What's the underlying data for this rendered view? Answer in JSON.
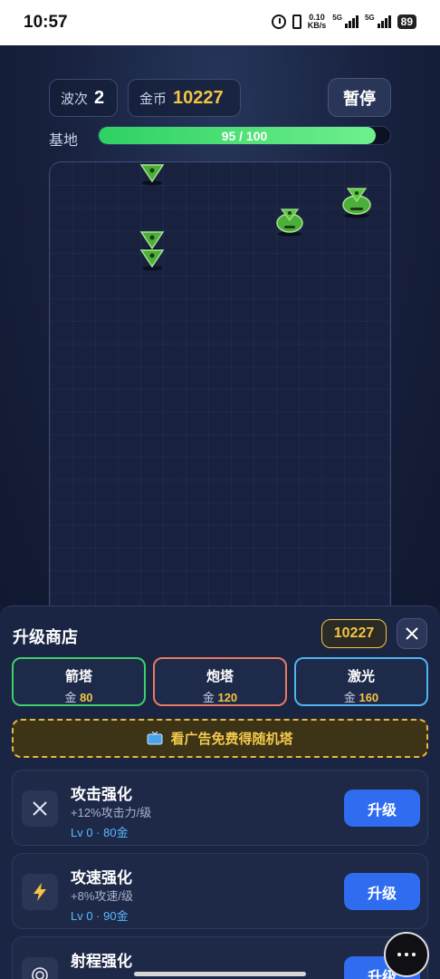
{
  "status_bar": {
    "time": "10:57",
    "net_speed_value": "0.10",
    "net_speed_unit": "KB/s",
    "sim1_label": "5G",
    "sim2_label": "5G",
    "battery": "89"
  },
  "hud": {
    "wave_label": "波次",
    "wave_value": "2",
    "gold_label": "金币",
    "gold_value": "10227",
    "pause_label": "暂停",
    "base_label": "基地",
    "base_text": "95 / 100",
    "base_fraction": 0.95
  },
  "shop": {
    "title": "升级商店",
    "coins": "10227",
    "currency": "金",
    "towers": [
      {
        "name": "箭塔",
        "cost": "80",
        "border_color": "#3fcf6a"
      },
      {
        "name": "炮塔",
        "cost": "120",
        "border_color": "#ea7a63"
      },
      {
        "name": "激光",
        "cost": "160",
        "border_color": "#4fb4f0"
      }
    ],
    "ad_icon": "tv-icon",
    "ad_label": "看广告免费得随机塔",
    "upgrades": [
      {
        "icon": "crossed-swords-icon",
        "name": "攻击强化",
        "desc": "+12%攻击力/级",
        "level": "Lv 0 · 80金",
        "button": "升级"
      },
      {
        "icon": "lightning-icon",
        "name": "攻速强化",
        "desc": "+8%攻速/级",
        "level": "Lv 0 · 90金",
        "button": "升级"
      },
      {
        "icon": "target-icon",
        "name": "射程强化",
        "desc": "",
        "level": "",
        "button": "升级"
      }
    ]
  },
  "colors": {
    "accent_gold": "#f5c542",
    "health_green": "#2ed162",
    "upgrade_blue": "#2f6cf0",
    "enemy_green": "#4caf3a"
  }
}
